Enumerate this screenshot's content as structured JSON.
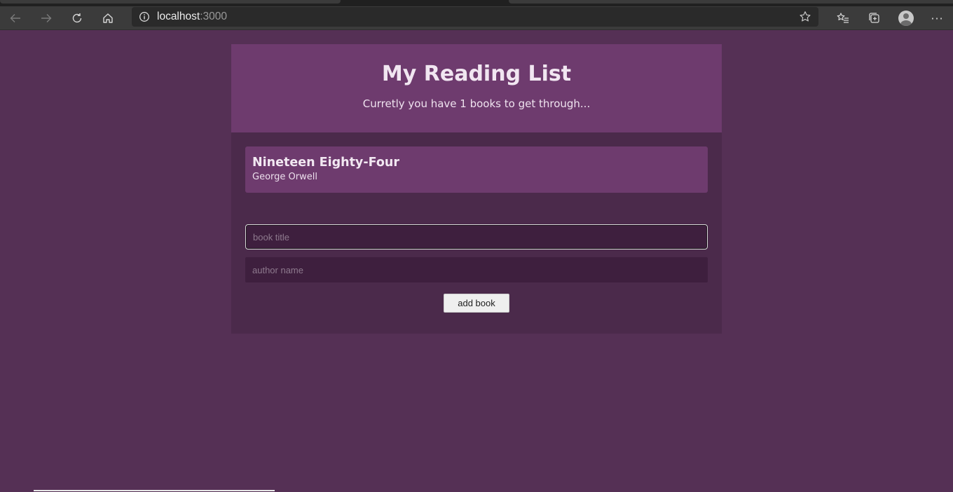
{
  "browser": {
    "url_host": "localhost",
    "url_port": ":3000",
    "icons": {
      "back": "back-arrow-icon",
      "forward": "forward-arrow-icon",
      "refresh": "refresh-icon",
      "home": "home-icon",
      "info": "info-icon",
      "favorite": "star-icon",
      "favorites": "favorites-list-icon",
      "collections": "collections-icon",
      "profile": "profile-avatar-icon",
      "menu": "more-icon"
    },
    "menu_label": "···"
  },
  "app": {
    "title": "My Reading List",
    "subtitle": "Curretly you have 1 books to get through...",
    "books": [
      {
        "title": "Nineteen Eighty-Four",
        "author": "George Orwell"
      }
    ],
    "form": {
      "title_placeholder": "book title",
      "author_placeholder": "author name",
      "submit_label": "add book"
    }
  },
  "colors": {
    "page_bg": "#553055",
    "header_bg": "#6e3b6e",
    "panel_bg": "#4b2a4b",
    "input_bg": "#3e1f3e"
  }
}
